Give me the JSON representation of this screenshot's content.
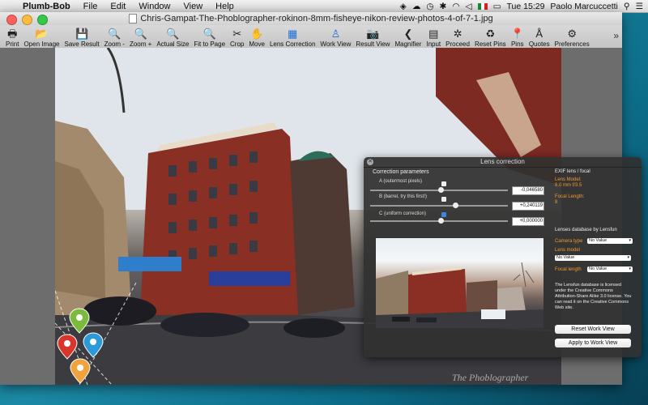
{
  "menubar": {
    "app_name": "Plumb-Bob",
    "menus": [
      "File",
      "Edit",
      "Window",
      "View",
      "Help"
    ],
    "status": {
      "clock": "Tue 15:29",
      "user": "Paolo Marcuccetti"
    }
  },
  "window": {
    "title": "Chris-Gampat-The-Phoblographer-rokinon-8mm-fisheye-nikon-review-photos-4-of-7-1.jpg"
  },
  "toolbar": [
    {
      "label": "Print",
      "icon": "print-icon",
      "glyph": "🖶"
    },
    {
      "label": "Open Image",
      "icon": "folder-icon",
      "glyph": "📂"
    },
    {
      "label": "Save Result",
      "icon": "save-icon",
      "glyph": "💾"
    },
    {
      "label": "Zoom -",
      "icon": "zoom-out-icon",
      "glyph": "🔍"
    },
    {
      "label": "Zoom +",
      "icon": "zoom-in-icon",
      "glyph": "🔍"
    },
    {
      "label": "Actual Size",
      "icon": "actual-size-icon",
      "glyph": "🔍"
    },
    {
      "label": "Fit to Page",
      "icon": "fit-page-icon",
      "glyph": "🔍"
    },
    {
      "label": "Crop",
      "icon": "scissors-icon",
      "glyph": "✂"
    },
    {
      "label": "Move",
      "icon": "hand-icon",
      "glyph": "✋"
    },
    {
      "label": "Lens Correction",
      "icon": "grid-icon",
      "glyph": "▦"
    },
    {
      "label": "Work View",
      "icon": "person-icon",
      "glyph": "♙"
    },
    {
      "label": "Result View",
      "icon": "camera-icon",
      "glyph": "📷"
    },
    {
      "label": "Magnifier",
      "icon": "magnifier-icon",
      "glyph": "❮"
    },
    {
      "label": "Input",
      "icon": "calculator-icon",
      "glyph": "▤"
    },
    {
      "label": "Proceed",
      "icon": "proceed-icon",
      "glyph": "✲"
    },
    {
      "label": "Reset Pins",
      "icon": "recycle-icon",
      "glyph": "♻"
    },
    {
      "label": "Pins",
      "icon": "pin-icon",
      "glyph": "📍"
    },
    {
      "label": "Quotes",
      "icon": "quotes-icon",
      "glyph": "Å"
    },
    {
      "label": "Preferences",
      "icon": "gears-icon",
      "glyph": "⚙"
    }
  ],
  "lens_dialog": {
    "title": "Lens correction",
    "section_title": "Correction parameters",
    "params": [
      {
        "label": "A (outermost pixels)",
        "checked": false,
        "value": "-0,046580",
        "position": 0.51
      },
      {
        "label": "B (barrel, try this first!)",
        "checked": false,
        "value": "+0,240119",
        "position": 0.62
      },
      {
        "label": "C (uniform correction)",
        "checked": true,
        "value": "+0,000000",
        "position": 0.51
      }
    ],
    "exif_title": "EXIF lens / focal",
    "lens_model_label": "Lens Model:",
    "lens_model_value": "8.0 mm f/3.5",
    "focal_length_label": "Focal Length:",
    "focal_length_value": "8",
    "lensfun_title": "Lenses database by Lensfun",
    "camera_type_label": "Camera type",
    "camera_type_value": "No Value",
    "lens_model_select_label": "Lens model",
    "lens_model_select_value": "No Value",
    "focal_length_select_label": "Focal length",
    "focal_length_select_value": "No Value",
    "license_text": "The Lensfun database is licensed under the Creative Commons Attribution-Share Alike 3.0 license. You can read it on the Creative Commons Web site.",
    "reset_button": "Reset Work View",
    "apply_button": "Apply to Work View"
  },
  "watermark": "The Phoblographer",
  "colors": {
    "accent_orange": "#f09a2e",
    "pin_green": "#7cba3d",
    "pin_red": "#d9362b",
    "pin_blue": "#2c9ad8",
    "pin_orange": "#f0a33c"
  }
}
